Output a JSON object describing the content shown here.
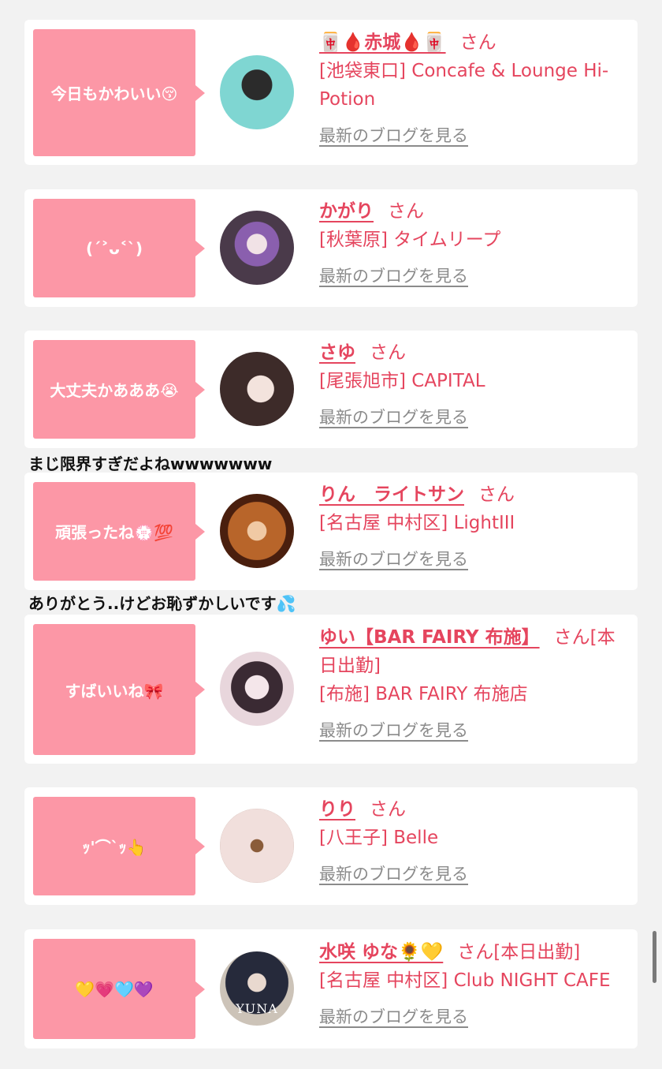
{
  "entries": [
    {
      "message": "今日もかわいい😚",
      "name": "🀄🩸赤城🩸🀄",
      "san": "さん",
      "shop": "[池袋東口] Concafe & Lounge Hi-Potion",
      "blog": "最新のブログを見る",
      "avatar_colors": [
        "#7fd6d2",
        "#2b2b2b"
      ]
    },
    {
      "message": "(ˊ˃ᴗ˂ˋ)",
      "name": "かがり",
      "san": "さん",
      "shop": "[秋葉原] タイムリープ",
      "blog": "最新のブログを見る",
      "avatar_colors": [
        "#4a3a4a",
        "#8a5fae"
      ]
    },
    {
      "message": "大丈夫かあああ😭",
      "name": "さゆ",
      "san": "さん",
      "shop": "[尾張旭市] CAPITAL",
      "blog": "最新のブログを見る",
      "avatar_colors": [
        "#c9b4b0",
        "#3d2b29"
      ]
    },
    {
      "message": "頑張ったね💮💯",
      "name": "りん　ライトサン",
      "san": "さん",
      "shop": "[名古屋 中村区] LightIII",
      "blog": "最新のブログを見る",
      "avatar_colors": [
        "#b8652a",
        "#4a1f0e"
      ]
    },
    {
      "message": "すばいいね🎀",
      "name": "ゆい【BAR FAIRY 布施】",
      "san": "さん[本日出勤]",
      "shop": "[布施] BAR FAIRY 布施店",
      "blog": "最新のブログを見る",
      "avatar_colors": [
        "#e8d6dc",
        "#3a2a33"
      ]
    },
    {
      "message": "ｯ'⌒`ｯ👆",
      "name": "りり",
      "san": "さん",
      "shop": "[八王子] Belle",
      "blog": "最新のブログを見る",
      "avatar_colors": [
        "#f1dfdc",
        "#b89a8f"
      ]
    },
    {
      "message": "💛💗🩵💜",
      "name": "水咲 ゆな🌻💛",
      "san": "さん[本日出勤]",
      "shop": "[名古屋 中村区] Club NIGHT CAFE",
      "blog": "最新のブログを見る",
      "avatar_colors": [
        "#ccc3b8",
        "#262a3b"
      ],
      "avatar_text": "YUNA"
    }
  ],
  "between_texts": [
    "まじ限界すぎだよねwwwwwww",
    "ありがとう..けどお恥ずかしいです💦"
  ]
}
